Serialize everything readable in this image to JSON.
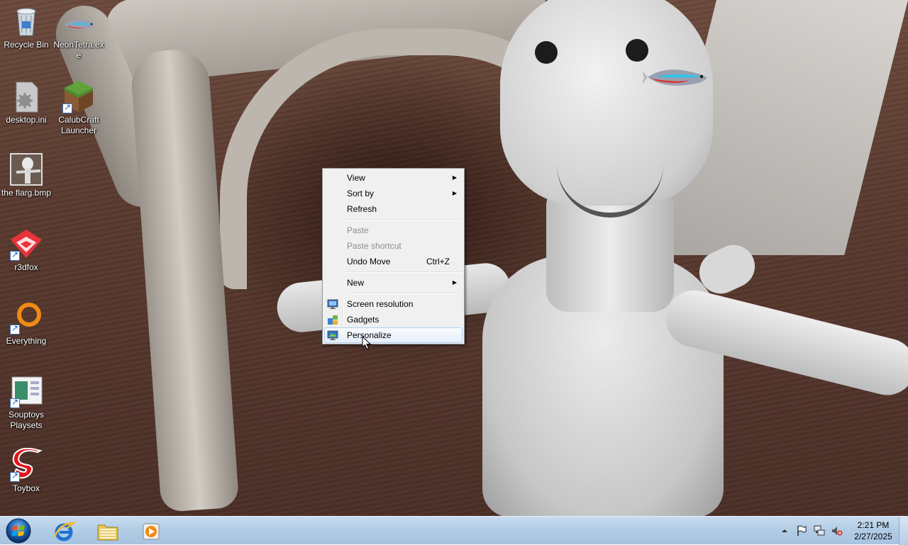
{
  "desktop": {
    "icons": [
      {
        "label": "Recycle Bin"
      },
      {
        "label": "NeonTetra.exe"
      },
      {
        "label": "desktop.ini"
      },
      {
        "label": "CalubCraft Launcher"
      },
      {
        "label": "the flarg.bmp"
      },
      {
        "label": "r3dfox"
      },
      {
        "label": "Everything"
      },
      {
        "label": "Souptoys Playsets"
      },
      {
        "label": "Toybox"
      }
    ]
  },
  "context_menu": {
    "items": [
      {
        "label": "View",
        "has_submenu": true
      },
      {
        "label": "Sort by",
        "has_submenu": true
      },
      {
        "label": "Refresh"
      },
      {
        "label": "Paste",
        "disabled": true
      },
      {
        "label": "Paste shortcut",
        "disabled": true
      },
      {
        "label": "Undo Move",
        "shortcut": "Ctrl+Z"
      },
      {
        "label": "New",
        "has_submenu": true
      },
      {
        "label": "Screen resolution",
        "icon": "screen-resolution-icon"
      },
      {
        "label": "Gadgets",
        "icon": "gadgets-icon"
      },
      {
        "label": "Personalize",
        "icon": "personalize-icon",
        "highlighted": true
      }
    ]
  },
  "taskbar": {
    "pinned": [
      {
        "name": "Internet Explorer",
        "icon": "internet-explorer-icon"
      },
      {
        "name": "Windows Explorer",
        "icon": "folder-icon"
      },
      {
        "name": "Windows Media Player",
        "icon": "media-player-icon"
      }
    ],
    "tray": {
      "icons": [
        "show-hidden-icons-arrow",
        "action-center-flag-icon",
        "network-icon",
        "volume-muted-icon"
      ],
      "time": "2:21 PM",
      "date": "2/27/2025"
    }
  },
  "colors": {
    "taskbar": "#b3cde6",
    "menu_background": "#f0f0f0",
    "menu_highlight_border": "#aecff7",
    "disabled_text": "#8d8d8d"
  }
}
